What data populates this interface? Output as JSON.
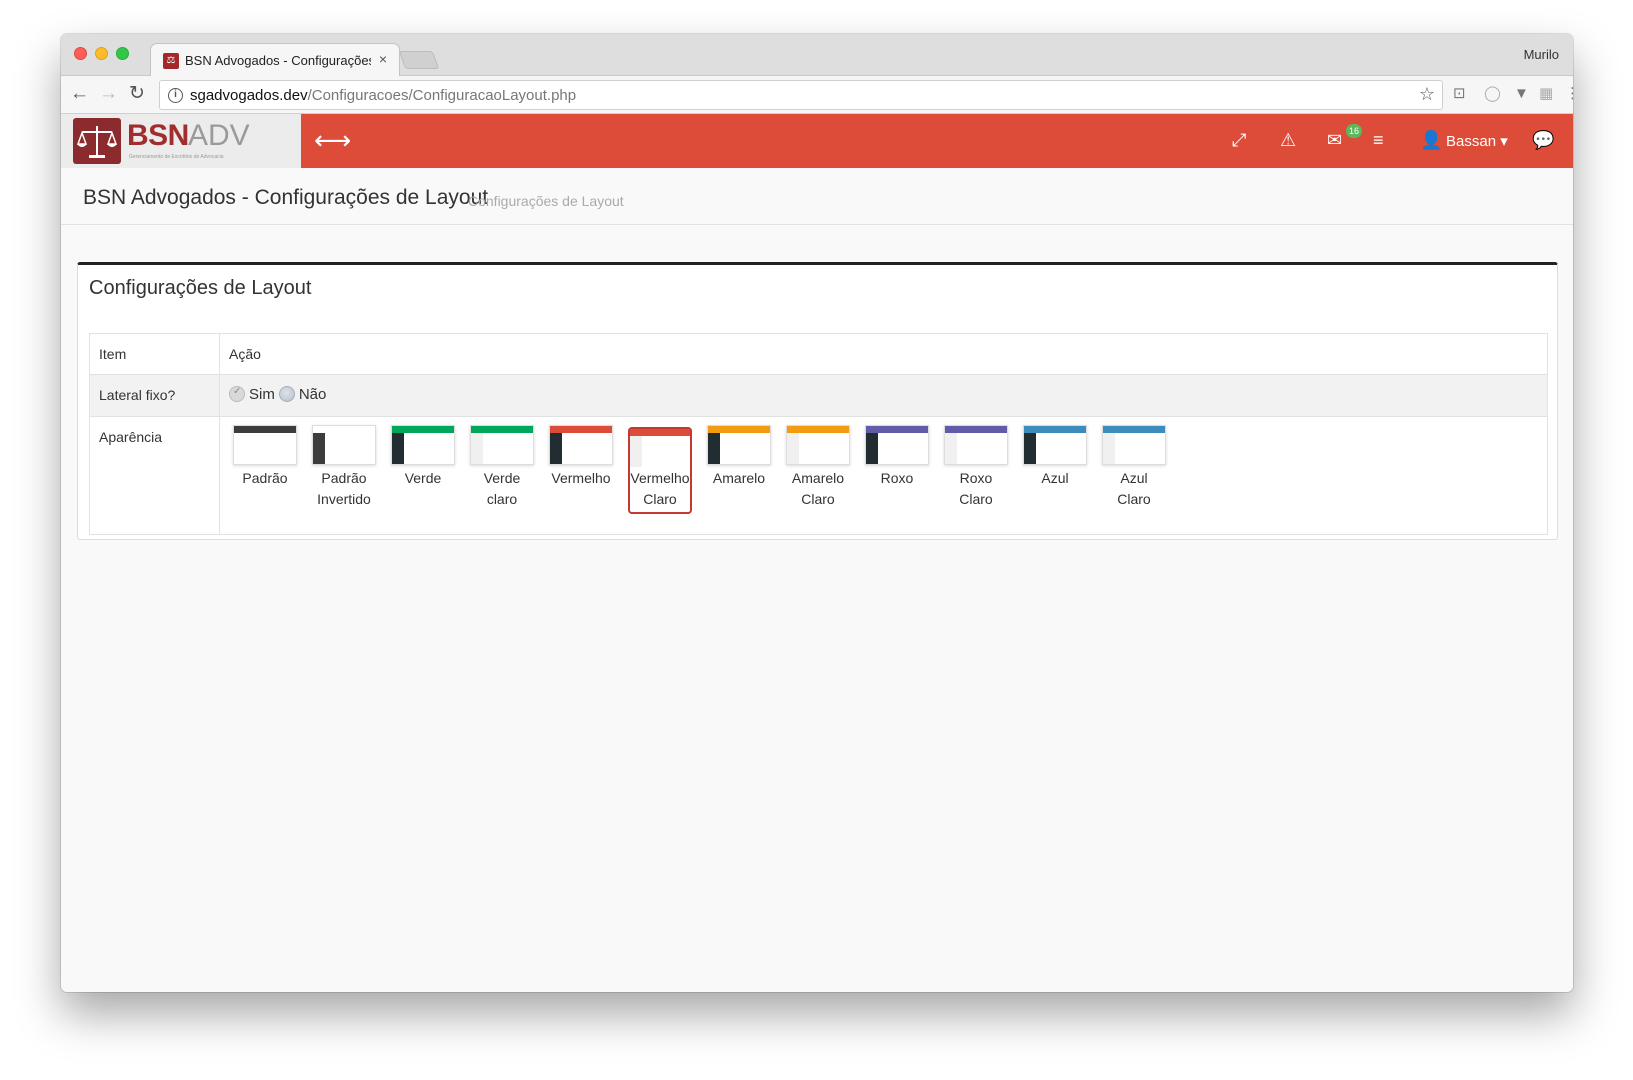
{
  "browser": {
    "tab_title": "BSN Advogados - Configurações de Layout",
    "tab_close": "×",
    "profile_name": "Murilo",
    "url_host": "sgadvogados.dev",
    "url_path": "/Configuracoes/ConfiguracaoLayout.php",
    "icons": {
      "back": "←",
      "forward": "→",
      "reload": "↻",
      "info": "i",
      "star": "☆",
      "cast": "⊡",
      "circle": "◯",
      "vivaldi": "▼",
      "grid": "▦",
      "menu": "⋮"
    }
  },
  "app": {
    "logo_bsn": "BSN",
    "logo_adv": "ADV",
    "logo_tagline": "Gerenciamento de Escritório de Advocacia",
    "logo_favicon": "⚖",
    "toggle_icon": "⟷",
    "header_icons": {
      "expand": "⤢",
      "alert": "⚠",
      "mail": "✉",
      "list": "≡",
      "user": "👤",
      "chat": "💬"
    },
    "mail_badge": "16",
    "user_name": "Bassan ▾",
    "brand_color": "#dd4b39"
  },
  "page": {
    "title": "BSN Advogados - Configurações de Layout",
    "subtitle": "Configurações de Layout"
  },
  "panel": {
    "title": "Configurações de Layout",
    "table": {
      "header_item": "Item",
      "header_acao": "Ação",
      "row_lateral_label": "Lateral fixo?",
      "option_sim": "Sim",
      "option_nao": "Não",
      "row_aparencia_label": "Aparência"
    },
    "skins": [
      {
        "label": "Padrão",
        "top": "#3c3c3c",
        "side": "#fff",
        "selected": false
      },
      {
        "label": "Padrão Invertido",
        "top": "#fff",
        "side": "#3c3c3c",
        "selected": false
      },
      {
        "label": "Verde",
        "top": "#00a65a",
        "side": "#222d32",
        "selected": false
      },
      {
        "label": "Verde claro",
        "top": "#00a65a",
        "side": "#f0f0f0",
        "selected": false
      },
      {
        "label": "Vermelho",
        "top": "#dd4b39",
        "side": "#222d32",
        "selected": false
      },
      {
        "label": "Vermelho Claro",
        "top": "#dd4b39",
        "side": "#f0f0f0",
        "selected": true
      },
      {
        "label": "Amarelo",
        "top": "#f39c12",
        "side": "#222d32",
        "selected": false
      },
      {
        "label": "Amarelo Claro",
        "top": "#f39c12",
        "side": "#f0f0f0",
        "selected": false
      },
      {
        "label": "Roxo",
        "top": "#605ca8",
        "side": "#222d32",
        "selected": false
      },
      {
        "label": "Roxo Claro",
        "top": "#605ca8",
        "side": "#f0f0f0",
        "selected": false
      },
      {
        "label": "Azul",
        "top": "#3c8dbc",
        "side": "#222d32",
        "selected": false
      },
      {
        "label": "Azul Claro",
        "top": "#3c8dbc",
        "side": "#f0f0f0",
        "selected": false
      }
    ]
  }
}
